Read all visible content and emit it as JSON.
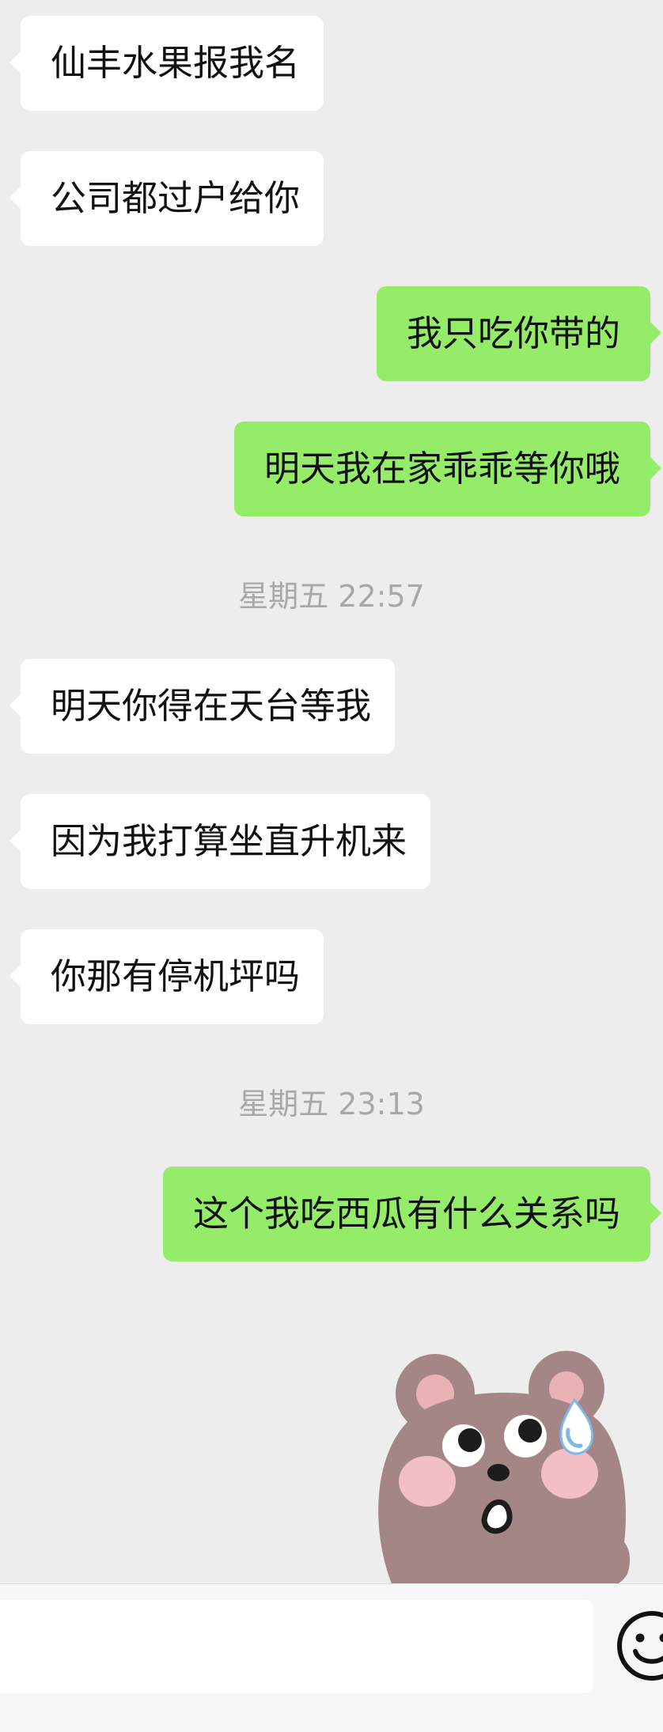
{
  "messages": [
    {
      "side": "in",
      "text": "仙丰水果报我名"
    },
    {
      "side": "in",
      "text": "公司都过户给你"
    },
    {
      "side": "out",
      "text": "我只吃你带的"
    },
    {
      "side": "out",
      "text": "明天我在家乖乖等你哦"
    },
    {
      "side": "in",
      "text": "明天你得在天台等我"
    },
    {
      "side": "in",
      "text": "因为我打算坐直升机来"
    },
    {
      "side": "in",
      "text": "你那有停机坪吗"
    },
    {
      "side": "out",
      "text": "这个我吃西瓜有什么关系吗"
    }
  ],
  "timestamps": [
    "星期五 22:57",
    "星期五 23:13"
  ],
  "sticker": {
    "icon": "bear-sweating-sticker-icon"
  },
  "input_bar": {
    "value": "",
    "emoji_icon": "smiley-face-icon"
  },
  "colors": {
    "background": "#ededed",
    "incoming_bubble": "#ffffff",
    "outgoing_bubble": "#95ec69",
    "timestamp_text": "#a8a8a8"
  }
}
